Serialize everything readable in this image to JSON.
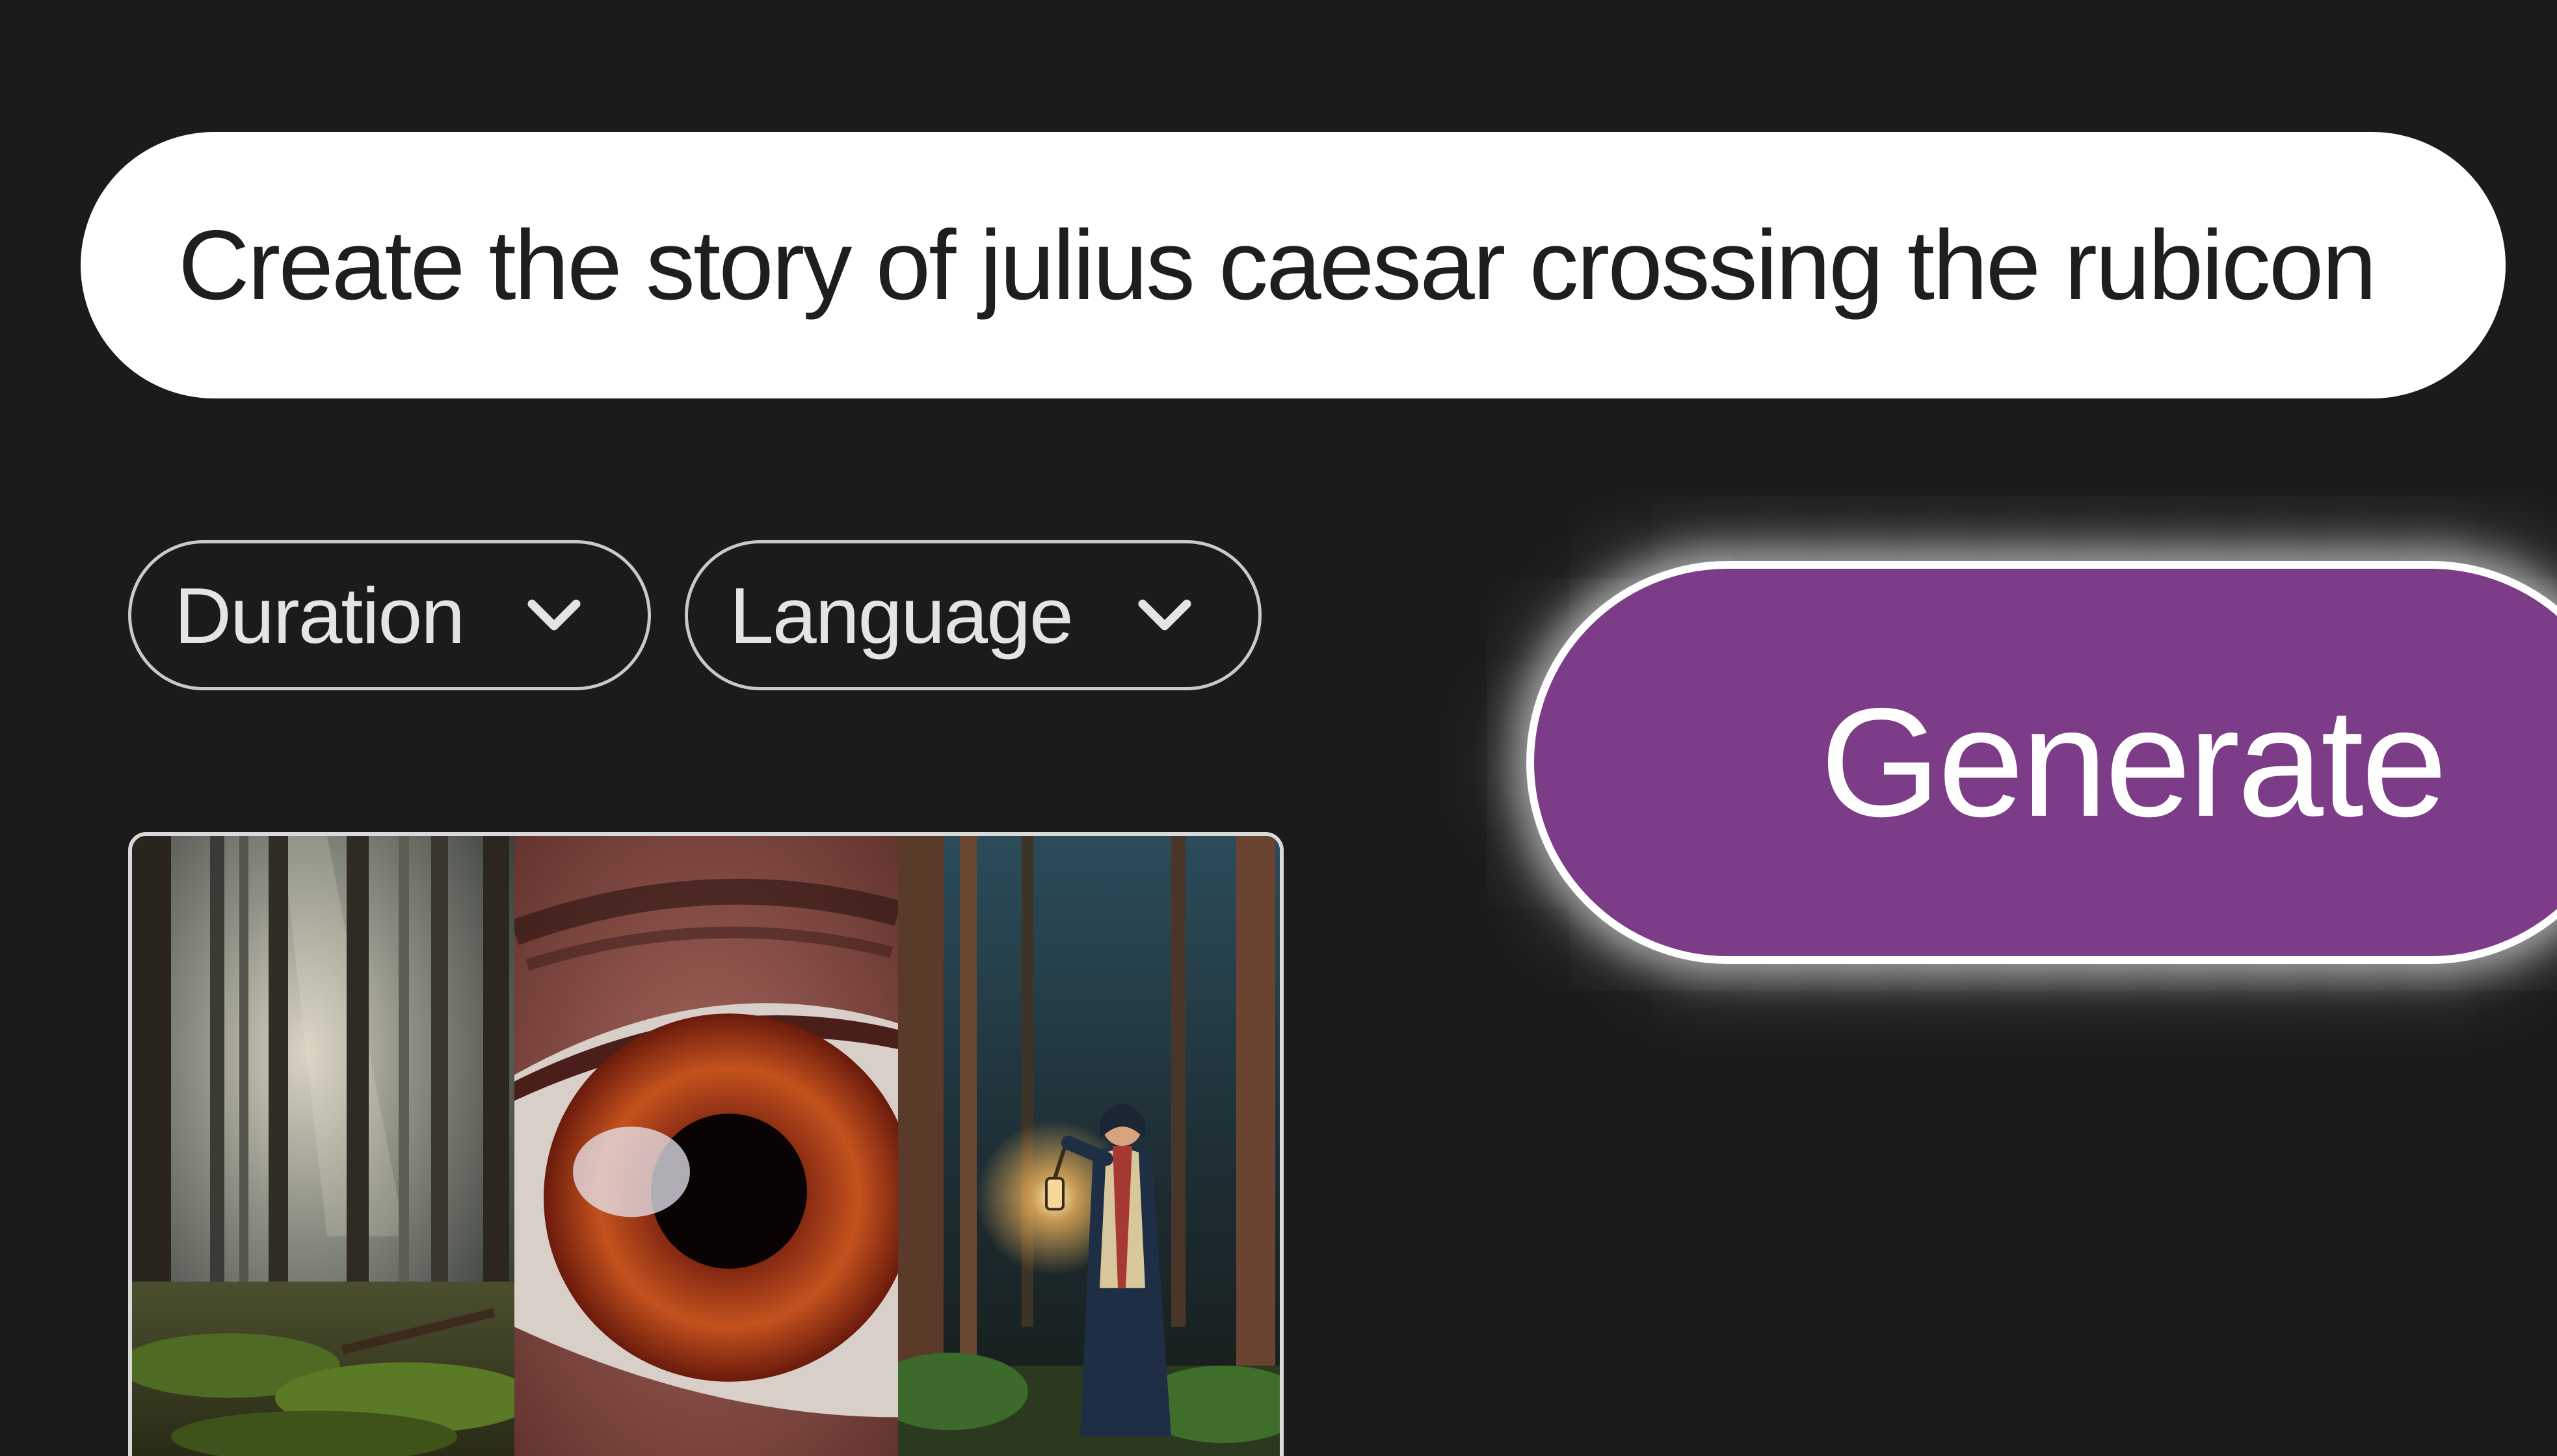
{
  "prompt": {
    "value": "Create the story of julius caesar crossing the rubicon"
  },
  "filters": [
    {
      "label": "Duration",
      "icon": "chevron-down-icon"
    },
    {
      "label": "Language",
      "icon": "chevron-down-icon"
    }
  ],
  "generate": {
    "label": "Generate"
  },
  "colors": {
    "background": "#1b1b1b",
    "accent": "#7c3c88",
    "prompt_bg": "#ffffff"
  },
  "gallery": {
    "images": [
      {
        "subject": "misty forest with sunbeams"
      },
      {
        "subject": "close-up of an amber eye"
      },
      {
        "subject": "woman with lantern in dark forest"
      }
    ]
  }
}
